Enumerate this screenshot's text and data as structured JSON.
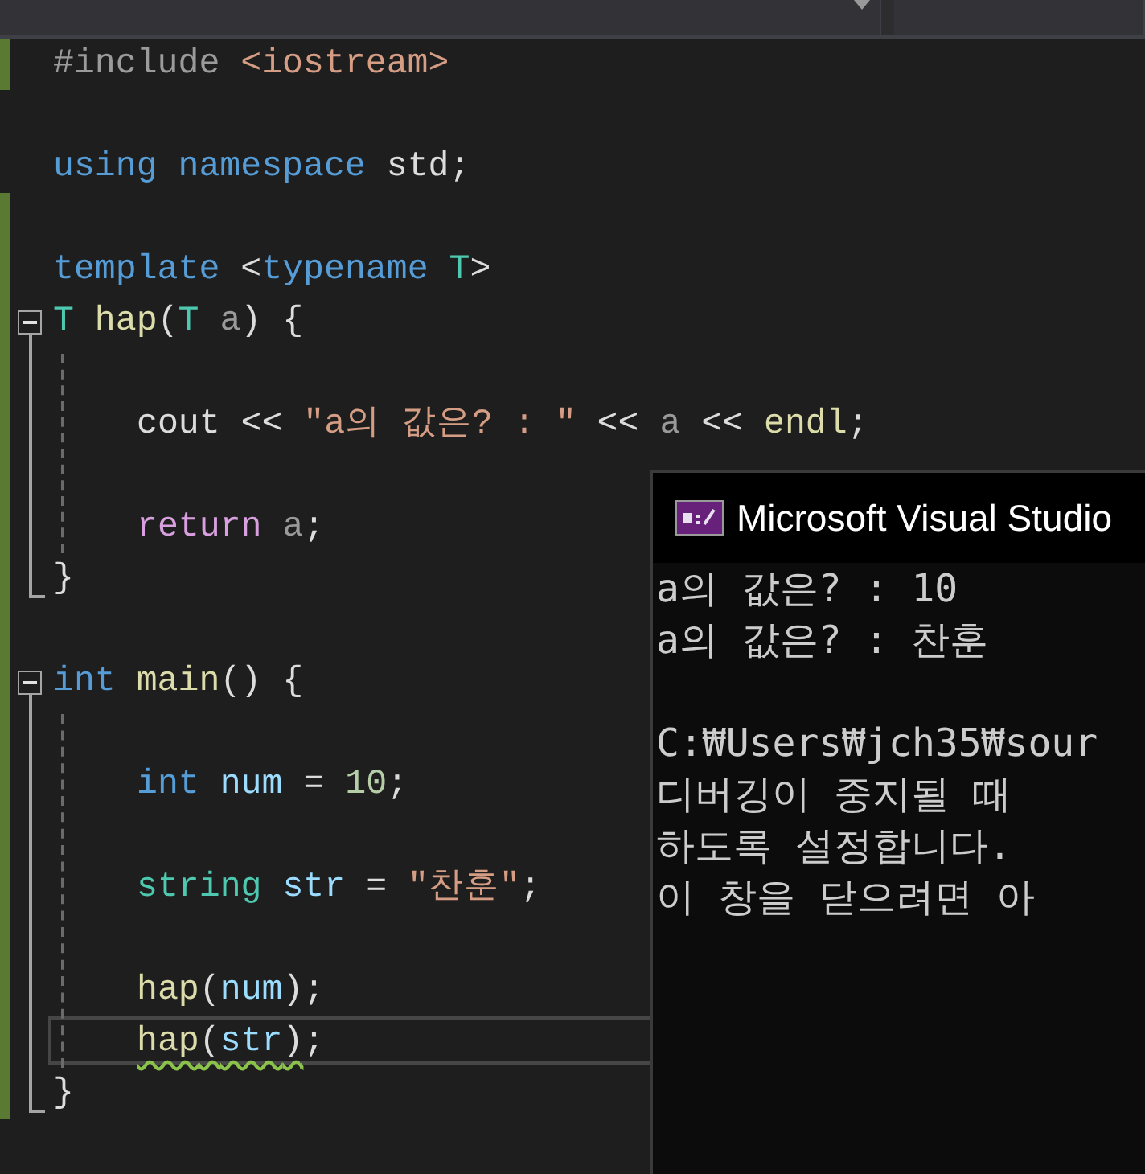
{
  "toolbar": {
    "dropdowns": [
      {
        "kind": "wide"
      },
      {
        "kind": "narrow"
      }
    ]
  },
  "editor": {
    "lines": [
      {
        "changed": true,
        "kind": "top",
        "tokens": [
          {
            "text": "#include ",
            "kind": "preproc"
          },
          {
            "text": "<iostream>",
            "kind": "string"
          }
        ]
      },
      {
        "changed": false,
        "kind": "top"
      },
      {
        "changed": false,
        "kind": "top",
        "tokens": [
          {
            "text": "using ",
            "kind": "keyword"
          },
          {
            "text": "namespace ",
            "kind": "keyword"
          },
          {
            "text": "std;",
            "kind": "plain"
          }
        ]
      },
      {
        "changed": true,
        "kind": "top"
      },
      {
        "changed": true,
        "kind": "top",
        "tokens": [
          {
            "text": "template ",
            "kind": "keyword"
          },
          {
            "text": "<",
            "kind": "plain"
          },
          {
            "text": "typename ",
            "kind": "keyword"
          },
          {
            "text": "T",
            "kind": "type"
          },
          {
            "text": ">",
            "kind": "plain"
          }
        ]
      },
      {
        "changed": true,
        "kind": "fold-start",
        "tokens": [
          {
            "text": "T ",
            "kind": "type"
          },
          {
            "text": "hap",
            "kind": "function"
          },
          {
            "text": "(",
            "kind": "plain"
          },
          {
            "text": "T ",
            "kind": "type"
          },
          {
            "text": "a",
            "kind": "param"
          },
          {
            "text": ") {",
            "kind": "plain"
          }
        ]
      },
      {
        "changed": true,
        "kind": "body"
      },
      {
        "changed": true,
        "kind": "body",
        "tokens": [
          {
            "text": "cout << ",
            "kind": "plain"
          },
          {
            "text": "\"a의 값은? : \"",
            "kind": "string"
          },
          {
            "text": " << ",
            "kind": "plain"
          },
          {
            "text": "a",
            "kind": "param"
          },
          {
            "text": " << ",
            "kind": "plain"
          },
          {
            "text": "endl",
            "kind": "function"
          },
          {
            "text": ";",
            "kind": "plain"
          }
        ]
      },
      {
        "changed": true,
        "kind": "body"
      },
      {
        "changed": true,
        "kind": "body",
        "tokens": [
          {
            "text": "return ",
            "kind": "control"
          },
          {
            "text": "a",
            "kind": "param"
          },
          {
            "text": ";",
            "kind": "plain"
          }
        ]
      },
      {
        "changed": true,
        "kind": "fold-end",
        "tokens": [
          {
            "text": "}",
            "kind": "plain"
          }
        ]
      },
      {
        "changed": true,
        "kind": "top"
      },
      {
        "changed": true,
        "kind": "fold-start",
        "tokens": [
          {
            "text": "int ",
            "kind": "keyword"
          },
          {
            "text": "main",
            "kind": "function"
          },
          {
            "text": "() {",
            "kind": "plain"
          }
        ]
      },
      {
        "changed": true,
        "kind": "body"
      },
      {
        "changed": true,
        "kind": "body",
        "tokens": [
          {
            "text": "int ",
            "kind": "keyword"
          },
          {
            "text": "num",
            "kind": "variable"
          },
          {
            "text": " = ",
            "kind": "plain"
          },
          {
            "text": "10",
            "kind": "number"
          },
          {
            "text": ";",
            "kind": "plain"
          }
        ]
      },
      {
        "changed": true,
        "kind": "body"
      },
      {
        "changed": true,
        "kind": "body",
        "tokens": [
          {
            "text": "string ",
            "kind": "type"
          },
          {
            "text": "str",
            "kind": "variable"
          },
          {
            "text": " = ",
            "kind": "plain"
          },
          {
            "text": "\"찬훈\"",
            "kind": "string"
          },
          {
            "text": ";",
            "kind": "plain"
          }
        ]
      },
      {
        "changed": true,
        "kind": "body"
      },
      {
        "changed": true,
        "kind": "body",
        "tokens": [
          {
            "text": "hap",
            "kind": "function"
          },
          {
            "text": "(",
            "kind": "plain"
          },
          {
            "text": "num",
            "kind": "variable"
          },
          {
            "text": ");",
            "kind": "plain"
          }
        ]
      },
      {
        "changed": true,
        "kind": "body",
        "current": true,
        "tokens": [
          {
            "text": "hap",
            "kind": "function",
            "error": true
          },
          {
            "text": "(",
            "kind": "plain",
            "error": true
          },
          {
            "text": "str",
            "kind": "variable",
            "error": true
          },
          {
            "text": ")",
            "kind": "plain",
            "error": true
          },
          {
            "text": ";",
            "kind": "plain",
            "error": false
          }
        ]
      },
      {
        "changed": true,
        "kind": "fold-end",
        "tokens": [
          {
            "text": "}",
            "kind": "plain"
          }
        ]
      }
    ]
  },
  "console": {
    "title": "Microsoft Visual Studio",
    "output": [
      "a의 값은? : 10",
      "a의 값은? : 찬훈"
    ],
    "messages": [
      "C:₩Users₩jch35₩sour",
      "디버깅이 중지될 때",
      "하도록 설정합니다.",
      "이 창을 닫으려면 아"
    ]
  }
}
